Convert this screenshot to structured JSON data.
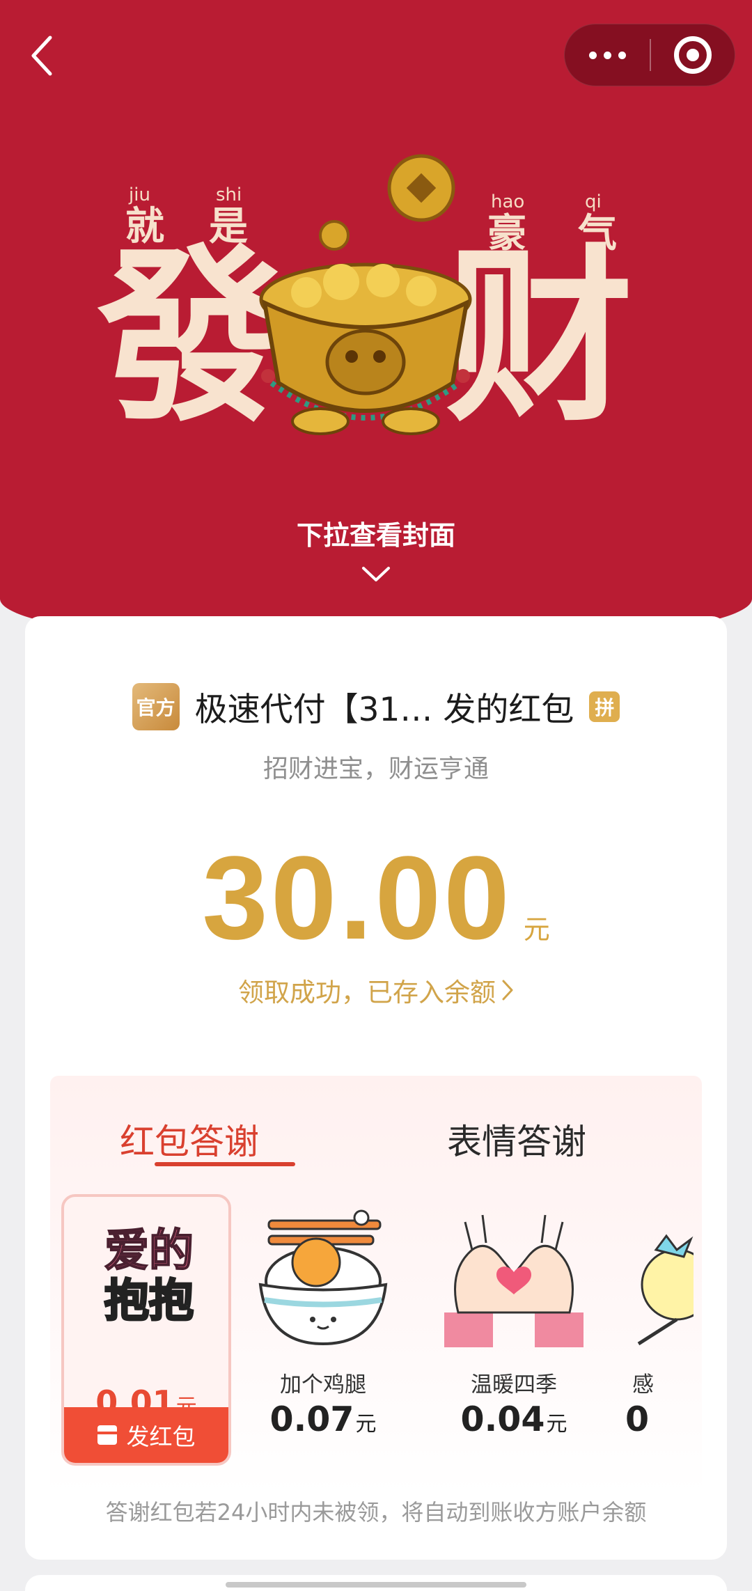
{
  "navigation": {
    "back_icon": "chevron-left-icon",
    "more_icon": "more-dots-icon",
    "close_icon": "target-circle-icon"
  },
  "cover": {
    "pinyin": [
      "jiu",
      "shi",
      "hao",
      "qi"
    ],
    "small_chars": [
      "就",
      "是",
      "豪",
      "气"
    ],
    "big_chars": [
      "發",
      "财"
    ],
    "pull_hint": "下拉查看封面",
    "background_color": "#b91c33"
  },
  "packet": {
    "official_badge": "官方",
    "sender": "极速代付【31… 发的红包",
    "group_badge": "拼",
    "blessing": "招财进宝，财运亨通",
    "amount": "30.00",
    "unit": "元",
    "received_text": "领取成功，已存入余额",
    "accent_color": "#d7a53f"
  },
  "thanks": {
    "tabs": [
      {
        "label": "红包答谢",
        "active": true
      },
      {
        "label": "表情答谢",
        "active": false
      }
    ],
    "items": [
      {
        "art_text": [
          "爱的",
          "抱抱"
        ],
        "price": "0.01",
        "unit": "元",
        "selected": true,
        "button": "发红包"
      },
      {
        "name": "加个鸡腿",
        "price": "0.07",
        "unit": "元"
      },
      {
        "name": "温暖四季",
        "price": "0.04",
        "unit": "元"
      },
      {
        "name": "感",
        "price": "0"
      }
    ],
    "footnote": "答谢红包若24小时内未被领，将自动到账收方账户余额",
    "accent_color": "#d9402f"
  }
}
